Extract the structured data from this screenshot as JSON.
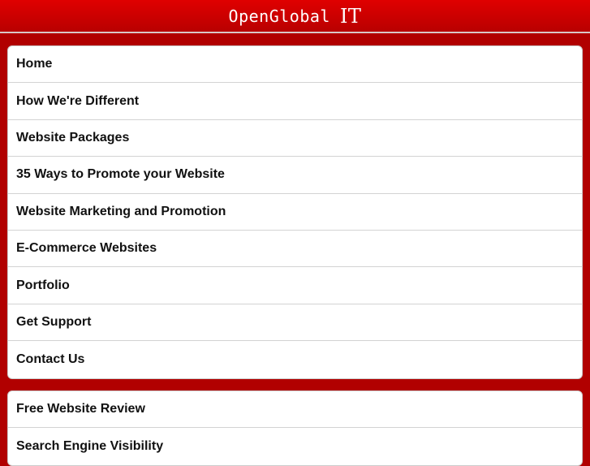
{
  "header": {
    "logo_text": "OpenGlobal",
    "logo_suffix": "IT"
  },
  "menu": [
    {
      "label": "Home"
    },
    {
      "label": "How We're Different"
    },
    {
      "label": "Website Packages"
    },
    {
      "label": "35 Ways to Promote your Website"
    },
    {
      "label": "Website Marketing and Promotion"
    },
    {
      "label": "E-Commerce Websites"
    },
    {
      "label": "Portfolio"
    },
    {
      "label": "Get Support"
    },
    {
      "label": "Contact Us"
    }
  ],
  "menu2": [
    {
      "label": "Free Website Review"
    },
    {
      "label": "Search Engine Visibility"
    }
  ],
  "colors": {
    "brand": "#b10000"
  }
}
